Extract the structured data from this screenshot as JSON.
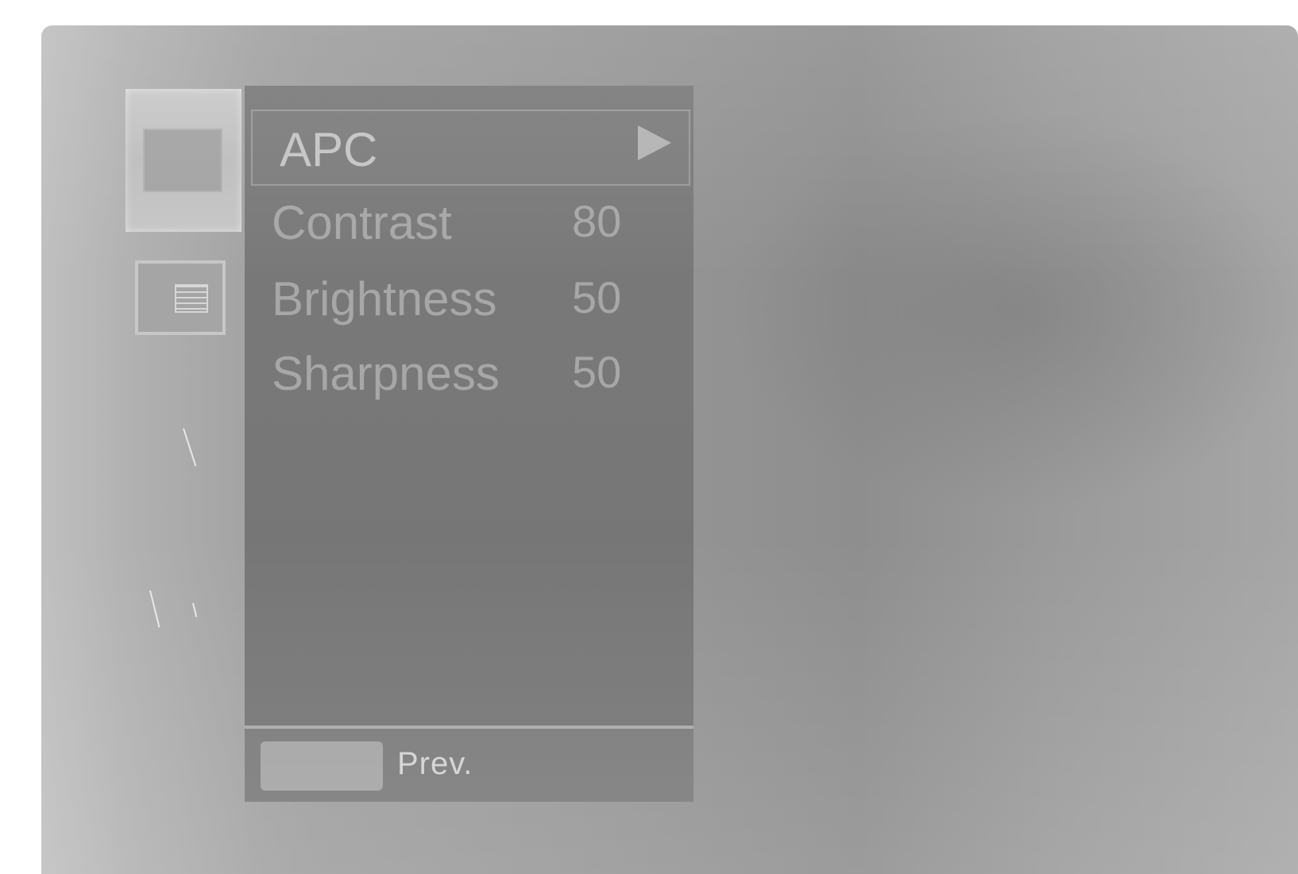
{
  "menu": {
    "items": [
      {
        "label": "APC",
        "value": "",
        "selected": true,
        "has_submenu": true
      },
      {
        "label": "Contrast",
        "value": "80",
        "selected": false,
        "has_submenu": false
      },
      {
        "label": "Brightness",
        "value": "50",
        "selected": false,
        "has_submenu": false
      },
      {
        "label": "Sharpness",
        "value": "50",
        "selected": false,
        "has_submenu": false
      }
    ]
  },
  "footer": {
    "prev_label": "Prev."
  },
  "icons": {
    "picture_tab": "picture-tab-icon",
    "list_tab": "list-tab-icon",
    "submenu_arrow": "right-triangle-arrow-icon"
  },
  "colors": {
    "menu_background": "#787878",
    "menu_text": "#a7a7a7",
    "selected_text": "#c4c4c4",
    "screen_background": "#9e9e9e"
  }
}
